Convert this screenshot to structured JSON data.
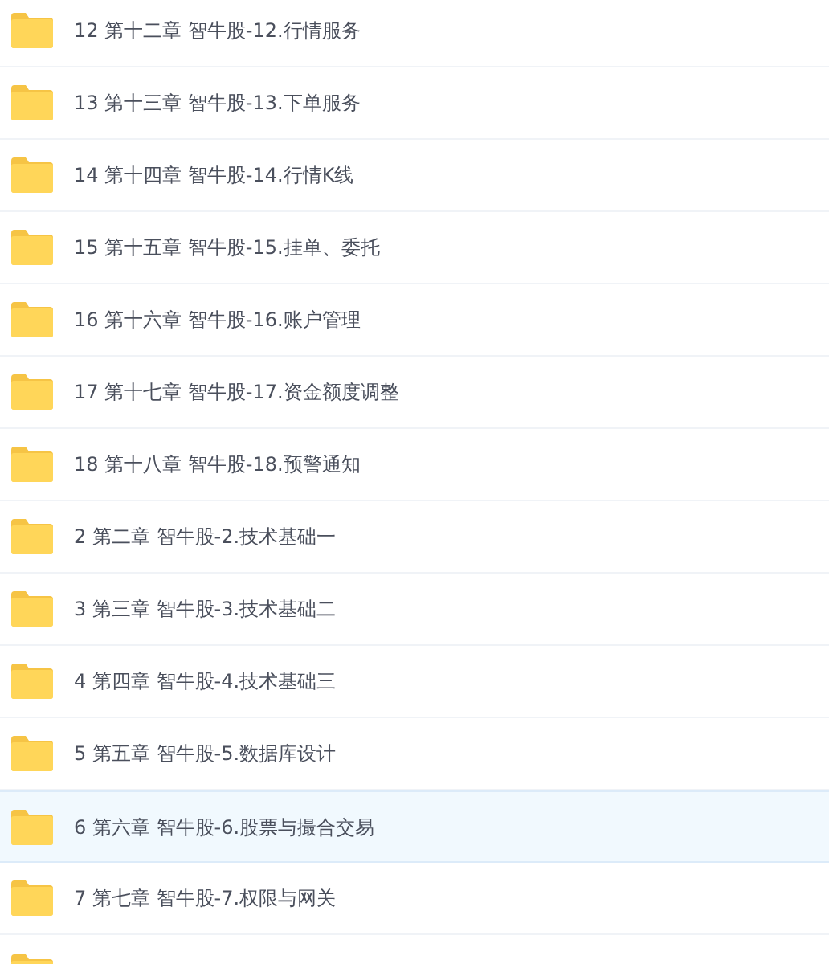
{
  "files": [
    {
      "name": "12 第十二章 智牛股-12.行情服务",
      "selected": false
    },
    {
      "name": "13 第十三章 智牛股-13.下单服务",
      "selected": false
    },
    {
      "name": "14 第十四章 智牛股-14.行情K线",
      "selected": false
    },
    {
      "name": "15 第十五章 智牛股-15.挂单、委托",
      "selected": false
    },
    {
      "name": "16 第十六章 智牛股-16.账户管理",
      "selected": false
    },
    {
      "name": "17 第十七章 智牛股-17.资金额度调整",
      "selected": false
    },
    {
      "name": "18 第十八章 智牛股-18.预警通知",
      "selected": false
    },
    {
      "name": "2 第二章 智牛股-2.技术基础一",
      "selected": false
    },
    {
      "name": "3 第三章 智牛股-3.技术基础二",
      "selected": false
    },
    {
      "name": "4 第四章 智牛股-4.技术基础三",
      "selected": false
    },
    {
      "name": "5 第五章 智牛股-5.数据库设计",
      "selected": false
    },
    {
      "name": "6 第六章 智牛股-6.股票与撮合交易",
      "selected": true
    },
    {
      "name": "7 第七章 智牛股-7.权限与网关",
      "selected": false
    }
  ]
}
